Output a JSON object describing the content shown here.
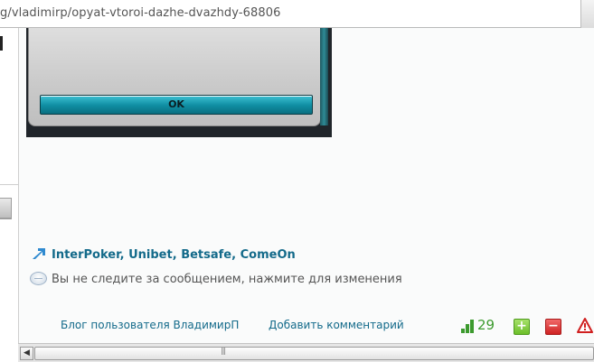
{
  "browser": {
    "url": "g/vladimirp/opyat-vtoroi-dazhe-dvazhdy-68806"
  },
  "post": {
    "dialog_ok_label": "OK",
    "poker_rooms": [
      "InterPoker",
      "Unibet",
      "Betsafe",
      "ComeOn"
    ],
    "poker_rooms_separator": ",",
    "follow_status": "Вы не следите за сообщением, нажмите для изменения"
  },
  "footer": {
    "blog_link": "Блог пользователя ВладимирП",
    "add_comment_link": "Добавить комментарий",
    "rating_value": "29",
    "vote_up_label": "+",
    "vote_down_label": "−"
  },
  "colors": {
    "link": "#136a8a",
    "rating_green": "#3c9a2e",
    "ok_button": "#0f8da2"
  },
  "icons": {
    "rooms_arrow": "arrow-icon",
    "follow": "speech-bubble-icon",
    "rating": "rating-bars-icon",
    "report": "warning-icon",
    "scroll_left": "scroll-left-arrow-icon"
  }
}
